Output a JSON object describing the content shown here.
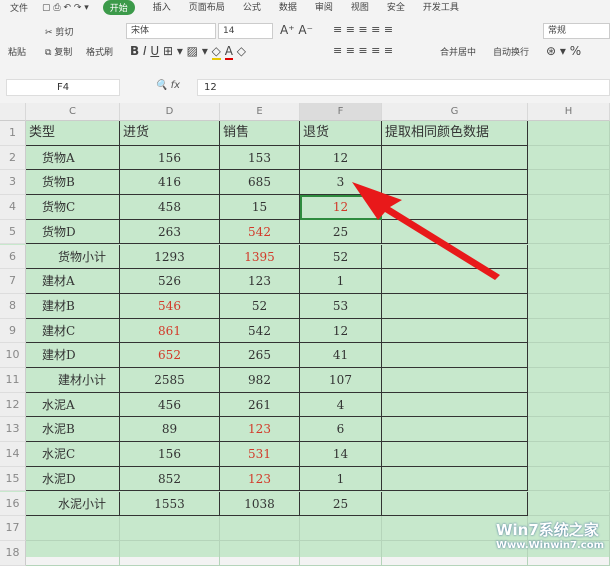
{
  "menu": {
    "file": "文件",
    "tabs": [
      "开始",
      "插入",
      "页面布局",
      "公式",
      "数据",
      "审阅",
      "视图",
      "安全",
      "开发工具"
    ]
  },
  "toolbar": {
    "paste": "粘贴",
    "cut": "剪切",
    "copy": "复制",
    "format_painter": "格式刷",
    "font": "宋体",
    "size": "14",
    "merge": "合并居中",
    "wrap": "自动换行",
    "number_format": "常规"
  },
  "formula_bar": {
    "cell": "F4",
    "fx": "fx",
    "value": "12"
  },
  "columns": [
    "C",
    "D",
    "E",
    "F",
    "G",
    "H"
  ],
  "rows": [
    [
      "类型",
      "进货",
      "销售",
      "退货",
      "提取相同颜色数据"
    ],
    [
      "货物A",
      "156",
      "153",
      "12",
      ""
    ],
    [
      "货物B",
      "416",
      "685",
      "3",
      ""
    ],
    [
      "货物C",
      "458",
      "15",
      "12",
      ""
    ],
    [
      "货物D",
      "263",
      "542",
      "25",
      ""
    ],
    [
      "货物小计",
      "1293",
      "1395",
      "52",
      ""
    ],
    [
      "建材A",
      "526",
      "123",
      "1",
      ""
    ],
    [
      "建材B",
      "546",
      "52",
      "53",
      ""
    ],
    [
      "建材C",
      "861",
      "542",
      "12",
      ""
    ],
    [
      "建材D",
      "652",
      "265",
      "41",
      ""
    ],
    [
      "建材小计",
      "2585",
      "982",
      "107",
      ""
    ],
    [
      "水泥A",
      "456",
      "261",
      "4",
      ""
    ],
    [
      "水泥B",
      "89",
      "123",
      "6",
      ""
    ],
    [
      "水泥C",
      "156",
      "531",
      "14",
      ""
    ],
    [
      "水泥D",
      "852",
      "123",
      "1",
      ""
    ],
    [
      "水泥小计",
      "1553",
      "1038",
      "25",
      ""
    ]
  ],
  "red_cells": [
    "3-3",
    "4-2",
    "5-2",
    "7-1",
    "8-1",
    "9-1",
    "12-2",
    "13-2",
    "14-2"
  ],
  "extra_rows": [
    "17",
    "18"
  ],
  "watermark": {
    "title": "Win7系统之家",
    "url": "Www.Winwin7.com"
  },
  "colors": {
    "accent": "#3c9a4a",
    "sheet": "#c7e8cc",
    "red": "#d23a2a"
  }
}
